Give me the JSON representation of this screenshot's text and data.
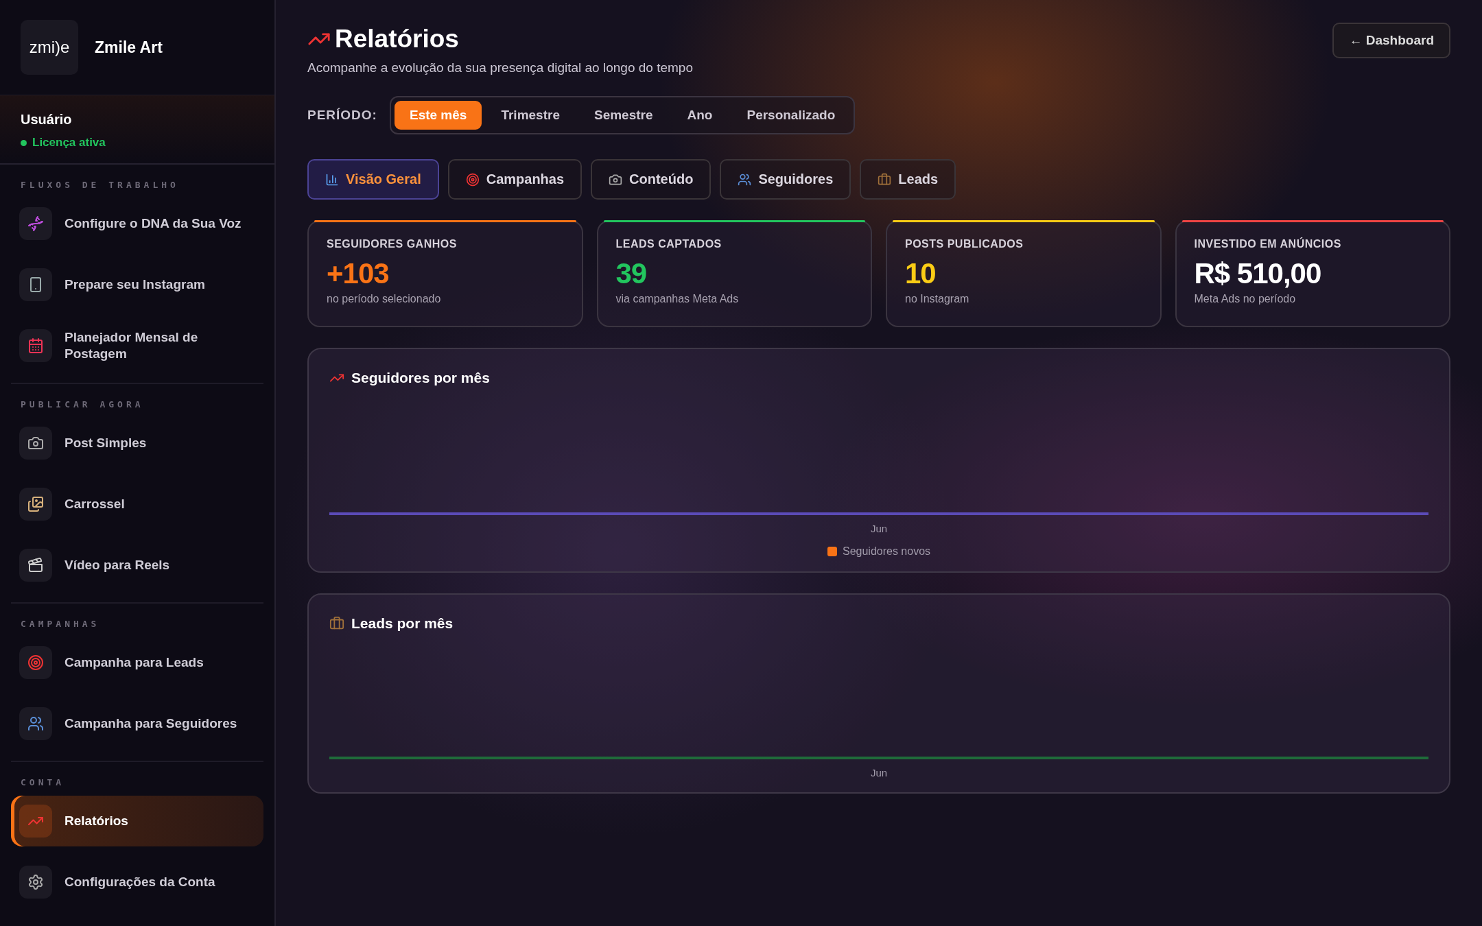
{
  "sidebar": {
    "logo": "zmi)e",
    "brand": "Zmile Art",
    "user": {
      "name": "Usuário",
      "status": "Licença ativa",
      "active": true
    },
    "sections": [
      {
        "title": "FLUXOS DE TRABALHO",
        "items": [
          {
            "label": "Configure o DNA da Sua Voz",
            "selected": false
          },
          {
            "label": "Prepare seu Instagram",
            "selected": false
          },
          {
            "label": "Planejador Mensal de Postagem",
            "selected": false
          }
        ]
      },
      {
        "title": "PUBLICAR AGORA",
        "items": [
          {
            "label": "Post Simples",
            "selected": false
          },
          {
            "label": "Carrossel",
            "selected": false
          },
          {
            "label": "Vídeo para Reels",
            "selected": false
          }
        ]
      },
      {
        "title": "CAMPANHAS",
        "items": [
          {
            "label": "Campanha para Leads",
            "selected": false
          },
          {
            "label": "Campanha para Seguidores",
            "selected": false
          }
        ]
      },
      {
        "title": "CONTA",
        "items": [
          {
            "label": "Relatórios",
            "selected": true
          },
          {
            "label": "Configurações da Conta",
            "selected": false
          }
        ]
      }
    ]
  },
  "header": {
    "title": "Relatórios",
    "subtitle": "Acompanhe a evolução da sua presença digital ao longo do tempo",
    "back_button": "← Dashboard"
  },
  "period": {
    "label": "PERÍODO:",
    "options": [
      {
        "label": "Este mês",
        "selected": true
      },
      {
        "label": "Trimestre",
        "selected": false
      },
      {
        "label": "Semestre",
        "selected": false
      },
      {
        "label": "Ano",
        "selected": false
      },
      {
        "label": "Personalizado",
        "selected": false
      }
    ]
  },
  "tabs": [
    {
      "label": "Visão Geral",
      "selected": true
    },
    {
      "label": "Campanhas",
      "selected": false
    },
    {
      "label": "Conteúdo",
      "selected": false
    },
    {
      "label": "Seguidores",
      "selected": false
    },
    {
      "label": "Leads",
      "selected": false
    }
  ],
  "stats": [
    {
      "title": "SEGUIDORES GANHOS",
      "value": "+103",
      "caption": "no período selecionado",
      "color": "#f97316",
      "kind": "count"
    },
    {
      "title": "LEADS CAPTADOS",
      "value": "39",
      "caption": "via campanhas Meta Ads",
      "color": "#22c55e",
      "kind": "count"
    },
    {
      "title": "POSTS PUBLICADOS",
      "value": "10",
      "caption": "no Instagram",
      "color": "#facc15",
      "kind": "count"
    },
    {
      "title": "INVESTIDO EM ANÚNCIOS",
      "value": "R$ 510,00",
      "caption": "Meta Ads no período",
      "color": "#ef4444",
      "kind": "money"
    }
  ],
  "charts": [
    {
      "title": "Seguidores por mês",
      "x_label": "Jun",
      "color": "#5b4bb8",
      "legend": {
        "label": "Seguidores novos",
        "color": "#f97316"
      }
    },
    {
      "title": "Leads por mês",
      "x_label": "Jun",
      "color": "#1f6b3a"
    }
  ]
}
